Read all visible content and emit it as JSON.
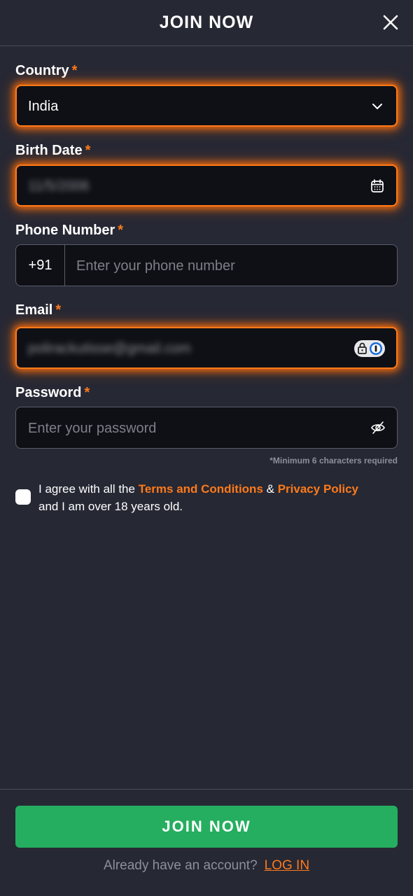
{
  "header": {
    "title": "JOIN NOW"
  },
  "icons": {
    "close": "close-icon",
    "chevron": "chevron-down-icon",
    "calendar": "calendar-icon",
    "password_manager": "password-manager-icon",
    "eye": "eye-off-icon"
  },
  "colors": {
    "background": "#262834",
    "field_background": "#0f1015",
    "accent": "#ff7a1a",
    "primary_button": "#25ae5f",
    "muted_text": "#8d8f9b"
  },
  "form": {
    "required_mark": "*",
    "country": {
      "label": "Country",
      "value": "India"
    },
    "birth_date": {
      "label": "Birth Date",
      "value": "11/5/2006"
    },
    "phone": {
      "label": "Phone Number",
      "prefix": "+91",
      "placeholder": "Enter your phone number"
    },
    "email": {
      "label": "Email",
      "value": "polirackutisse@gmail.com"
    },
    "password": {
      "label": "Password",
      "placeholder": "Enter your password",
      "hint": "*Minimum 6 characters required"
    },
    "agree": {
      "text_1": "I agree with all the",
      "terms_link": "Terms and Conditions",
      "amp": "&",
      "privacy_link": "Privacy Policy",
      "text_2": "and I am over 18 years old."
    }
  },
  "footer": {
    "join_button": "JOIN NOW",
    "login_prompt": "Already have an account?",
    "login_link": "LOG IN"
  }
}
